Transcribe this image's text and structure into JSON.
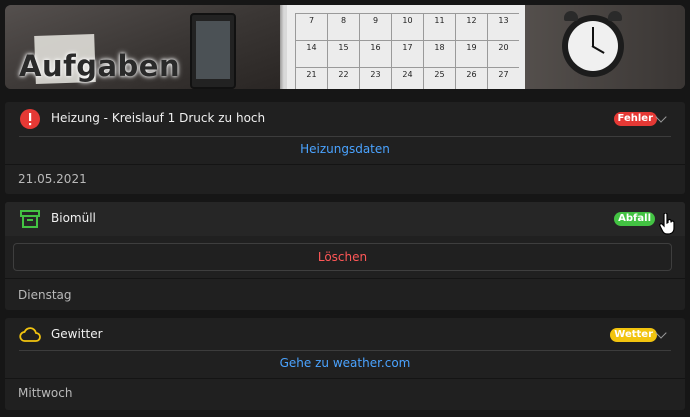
{
  "banner": {
    "title": "Aufgaben",
    "calendar_numbers": [
      "7",
      "8",
      "9",
      "10",
      "11",
      "12",
      "13",
      "14",
      "15",
      "16",
      "17",
      "18",
      "19",
      "20",
      "21",
      "22",
      "23",
      "24",
      "25",
      "26",
      "27"
    ]
  },
  "cards": [
    {
      "icon": "alert-circle-icon",
      "title": "Heizung - Kreislauf 1 Druck zu hoch",
      "badge": "Fehler",
      "badge_color": "#e53935",
      "action": "Heizungsdaten",
      "footer": "21.05.2021"
    },
    {
      "icon": "archive-box-icon",
      "title": "Biomüll",
      "badge": "Abfall",
      "badge_color": "#43c343",
      "action": "Löschen",
      "footer": "Dienstag"
    },
    {
      "icon": "cloud-icon",
      "title": "Gewitter",
      "badge": "Wetter",
      "badge_color": "#f2c40f",
      "action": "Gehe zu weather.com",
      "footer": "Mittwoch"
    }
  ],
  "colors": {
    "link": "#4aa3ff",
    "delete": "#ff5757",
    "card_bg": "#202020",
    "page_bg": "#161616"
  }
}
